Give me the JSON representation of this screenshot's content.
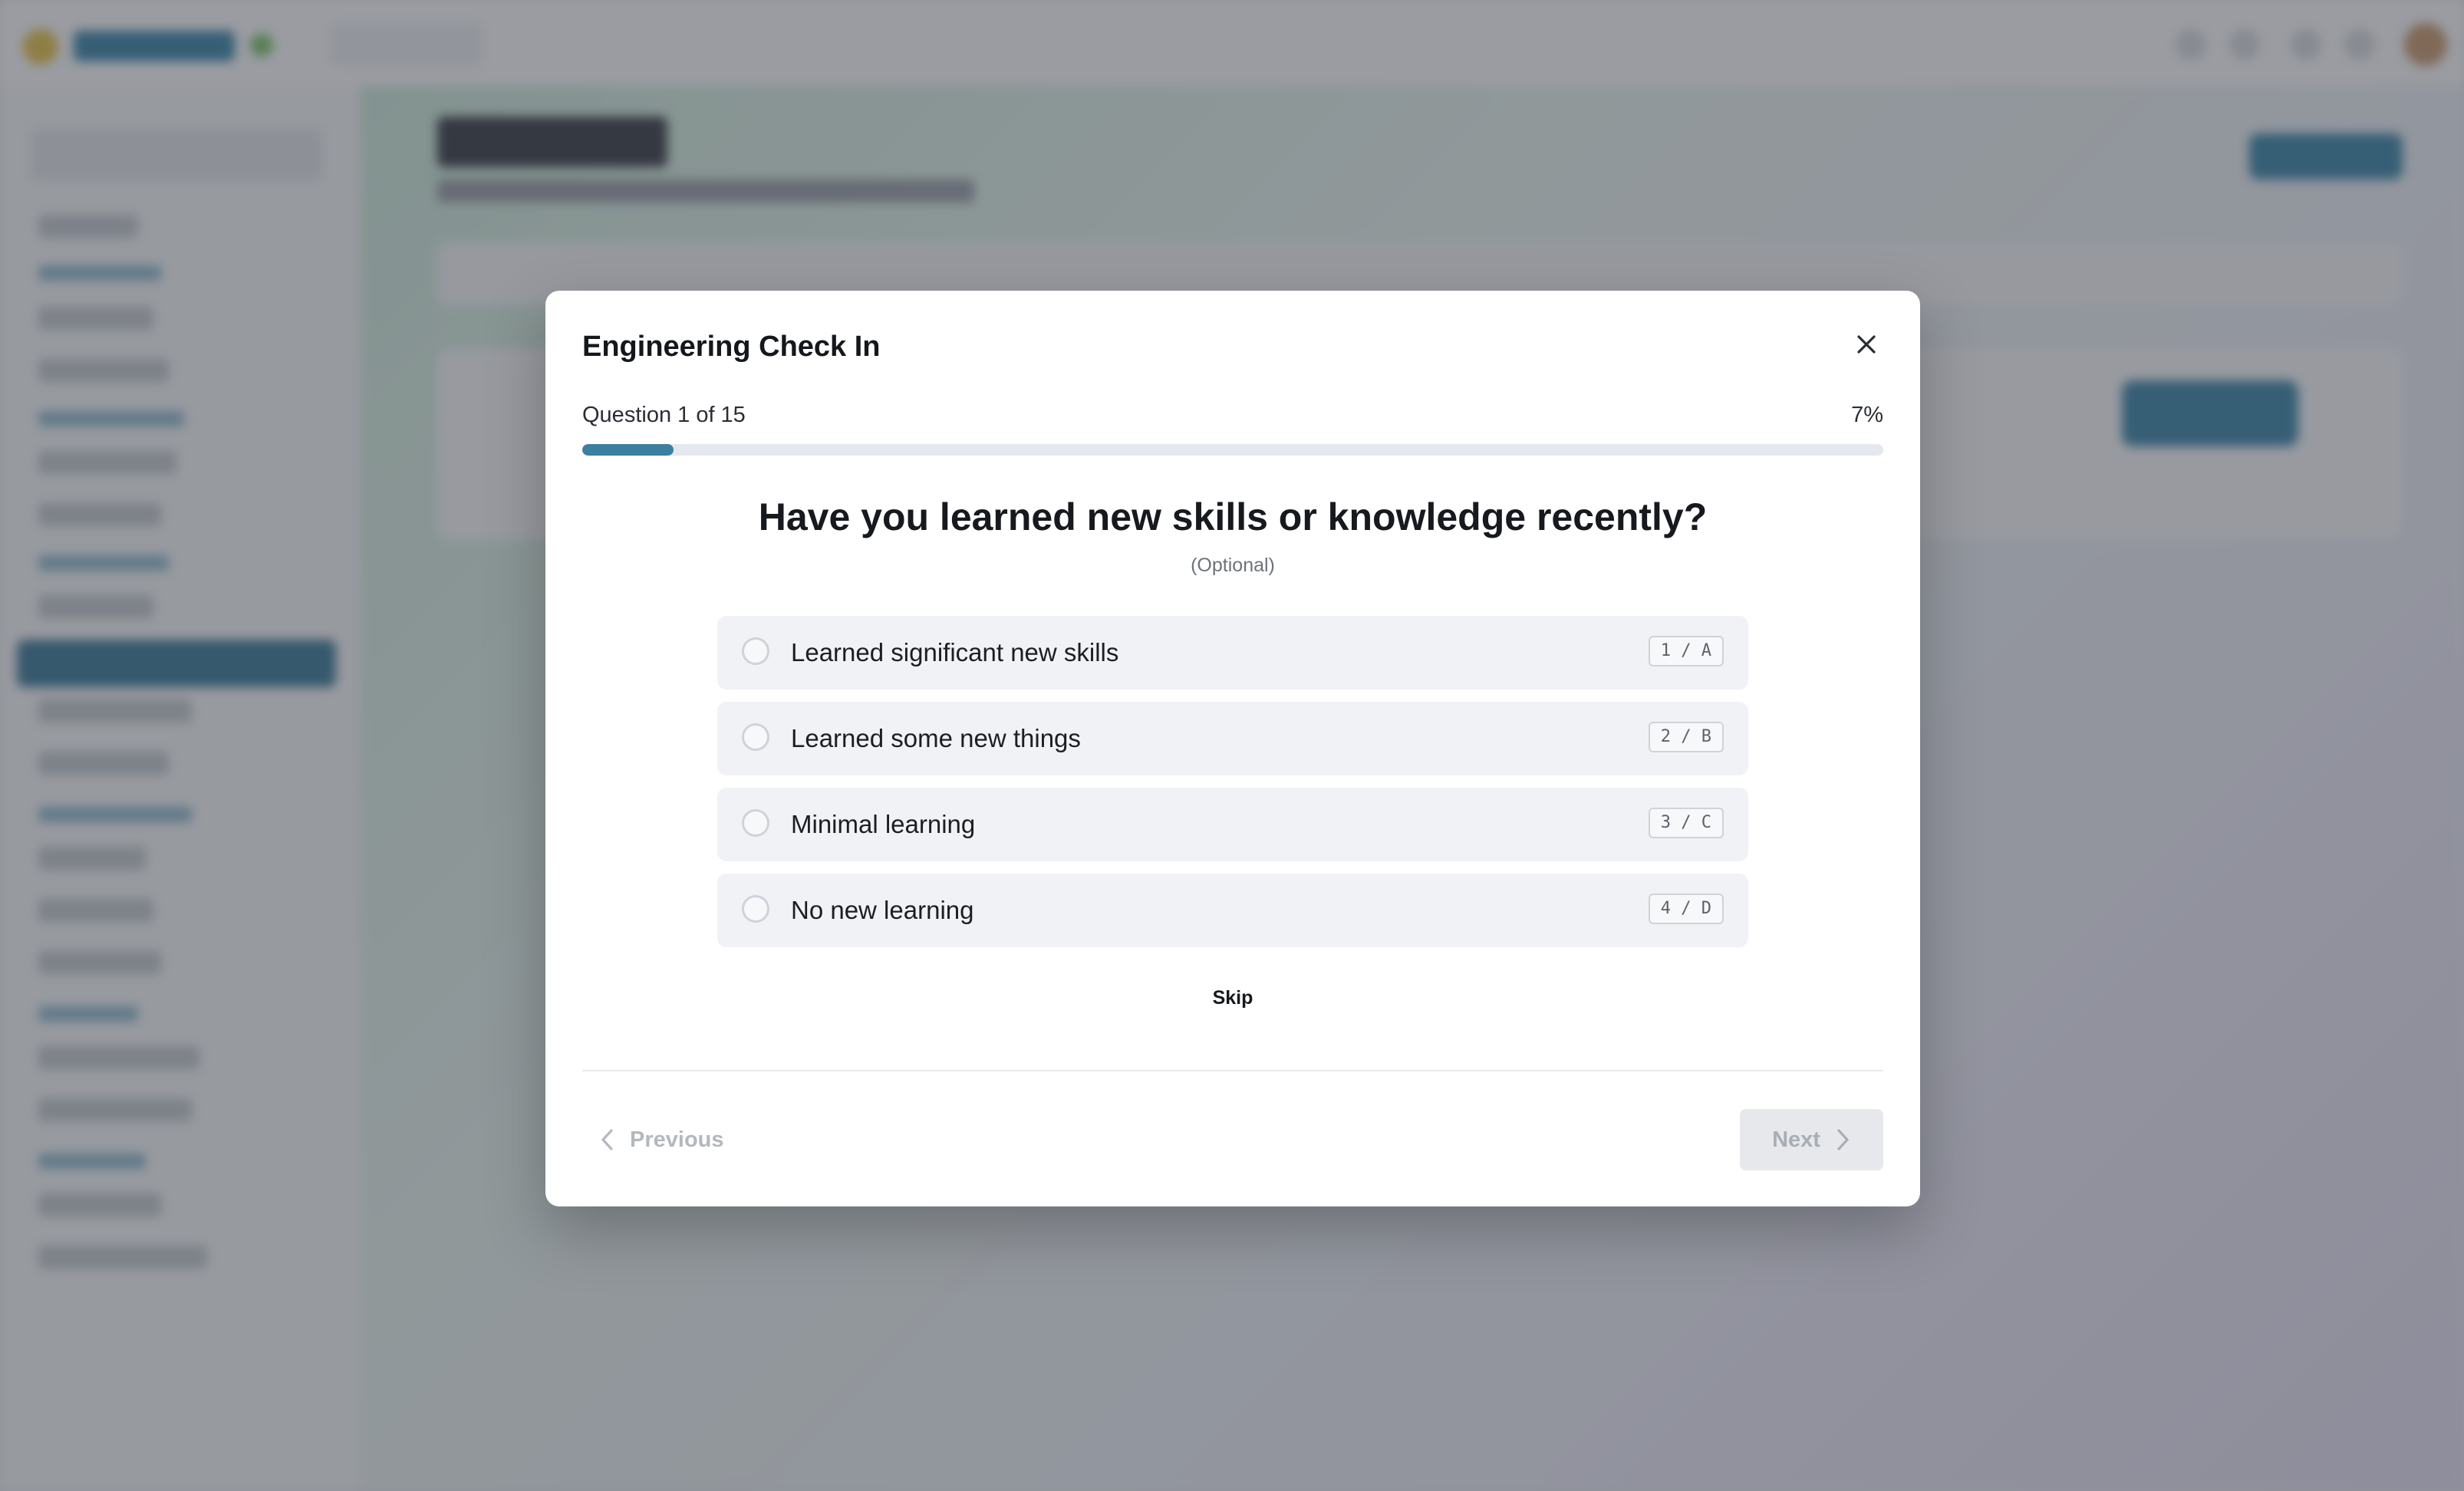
{
  "modal": {
    "title": "Engineering Check In",
    "progress": {
      "label": "Question 1 of 15",
      "percent_text": "7%",
      "current": 1,
      "total": 15,
      "percent": 7
    },
    "question": "Have you learned new skills or knowledge recently?",
    "optional_text": "(Optional)",
    "options": [
      {
        "label": "Learned significant new skills",
        "shortcut": "1 / A"
      },
      {
        "label": "Learned some new things",
        "shortcut": "2 / B"
      },
      {
        "label": "Minimal learning",
        "shortcut": "3 / C"
      },
      {
        "label": "No new learning",
        "shortcut": "4 / D"
      }
    ],
    "skip_label": "Skip",
    "previous_label": "Previous",
    "next_label": "Next"
  },
  "icons": {
    "close": "close-icon",
    "previous": "chevron-left-icon",
    "next": "chevron-right-icon"
  },
  "colors": {
    "accent": "#3b7fa1",
    "progress_track": "#e5e8ee",
    "option_background": "#f0f2f6",
    "disabled_text": "#a8aeb5"
  }
}
